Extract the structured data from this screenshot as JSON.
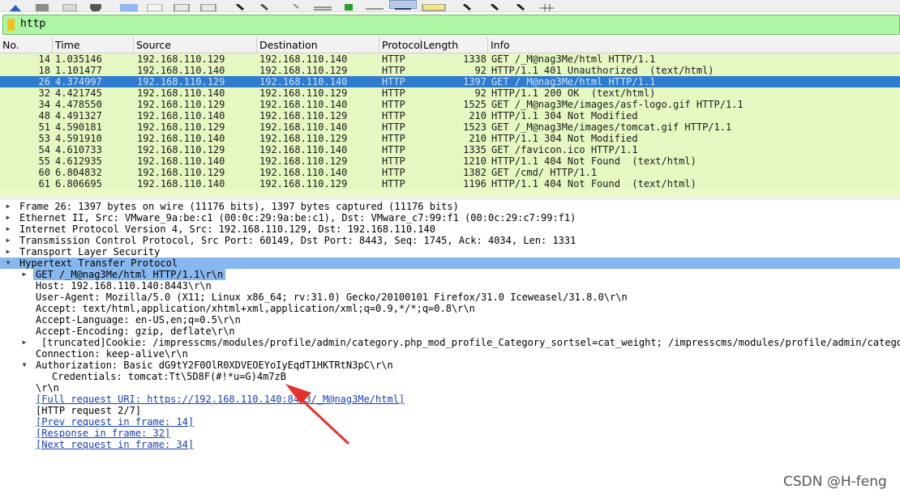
{
  "filter": {
    "text": "http"
  },
  "columns": [
    "No.",
    "Time",
    "Source",
    "Destination",
    "Protocol",
    "Length",
    "Info"
  ],
  "packets": [
    {
      "no": "14",
      "time": "1.035146",
      "src": "192.168.110.129",
      "dst": "192.168.110.140",
      "proto": "HTTP",
      "len": "1338",
      "info": "GET /_M@nag3Me/html HTTP/1.1"
    },
    {
      "no": "18",
      "time": "1.101477",
      "src": "192.168.110.140",
      "dst": "192.168.110.129",
      "proto": "HTTP",
      "len": "92",
      "info": "HTTP/1.1 401 Unauthorized  (text/html)"
    },
    {
      "no": "26",
      "time": "4.374997",
      "src": "192.168.110.129",
      "dst": "192.168.110.140",
      "proto": "HTTP",
      "len": "1397",
      "info": "GET /_M@nag3Me/html HTTP/1.1",
      "selected": true
    },
    {
      "no": "32",
      "time": "4.421745",
      "src": "192.168.110.140",
      "dst": "192.168.110.129",
      "proto": "HTTP",
      "len": "92",
      "info": "HTTP/1.1 200 OK  (text/html)"
    },
    {
      "no": "34",
      "time": "4.478550",
      "src": "192.168.110.129",
      "dst": "192.168.110.140",
      "proto": "HTTP",
      "len": "1525",
      "info": "GET /_M@nag3Me/images/asf-logo.gif HTTP/1.1"
    },
    {
      "no": "48",
      "time": "4.491327",
      "src": "192.168.110.140",
      "dst": "192.168.110.129",
      "proto": "HTTP",
      "len": "210",
      "info": "HTTP/1.1 304 Not Modified"
    },
    {
      "no": "51",
      "time": "4.590181",
      "src": "192.168.110.129",
      "dst": "192.168.110.140",
      "proto": "HTTP",
      "len": "1523",
      "info": "GET /_M@nag3Me/images/tomcat.gif HTTP/1.1"
    },
    {
      "no": "53",
      "time": "4.591910",
      "src": "192.168.110.140",
      "dst": "192.168.110.129",
      "proto": "HTTP",
      "len": "210",
      "info": "HTTP/1.1 304 Not Modified"
    },
    {
      "no": "54",
      "time": "4.610733",
      "src": "192.168.110.129",
      "dst": "192.168.110.140",
      "proto": "HTTP",
      "len": "1335",
      "info": "GET /favicon.ico HTTP/1.1"
    },
    {
      "no": "55",
      "time": "4.612935",
      "src": "192.168.110.140",
      "dst": "192.168.110.129",
      "proto": "HTTP",
      "len": "1210",
      "info": "HTTP/1.1 404 Not Found  (text/html)"
    },
    {
      "no": "60",
      "time": "6.804832",
      "src": "192.168.110.129",
      "dst": "192.168.110.140",
      "proto": "HTTP",
      "len": "1382",
      "info": "GET /cmd/ HTTP/1.1"
    },
    {
      "no": "61",
      "time": "6.806695",
      "src": "192.168.110.140",
      "dst": "192.168.110.129",
      "proto": "HTTP",
      "len": "1196",
      "info": "HTTP/1.1 404 Not Found  (text/html)"
    }
  ],
  "details": {
    "frame": "Frame 26: 1397 bytes on wire (11176 bits), 1397 bytes captured (11176 bits)",
    "ethernet": "Ethernet II, Src: VMware_9a:be:c1 (00:0c:29:9a:be:c1), Dst: VMware_c7:99:f1 (00:0c:29:c7:99:f1)",
    "ip": "Internet Protocol Version 4, Src: 192.168.110.129, Dst: 192.168.110.140",
    "tcp": "Transmission Control Protocol, Src Port: 60149, Dst Port: 8443, Seq: 1745, Ack: 4034, Len: 1331",
    "tls": "Transport Layer Security",
    "http": "Hypertext Transfer Protocol",
    "request_line": "GET /_M@nag3Me/html HTTP/1.1\\r\\n",
    "host": "Host: 192.168.110.140:8443\\r\\n",
    "user_agent": "User-Agent: Mozilla/5.0 (X11; Linux x86_64; rv:31.0) Gecko/20100101 Firefox/31.0 Iceweasel/31.8.0\\r\\n",
    "accept": "Accept: text/html,application/xhtml+xml,application/xml;q=0.9,*/*;q=0.8\\r\\n",
    "accept_language": "Accept-Language: en-US,en;q=0.5\\r\\n",
    "accept_encoding": "Accept-Encoding: gzip, deflate\\r\\n",
    "cookie": "[truncated]Cookie: /impresscms/modules/profile/admin/category.php_mod_profile_Category_sortsel=cat_weight; /impresscms/modules/profile/admin/categor",
    "connection": "Connection: keep-alive\\r\\n",
    "authorization": "Authorization: Basic dG9tY2F0OlR0XDVEOEYoIyEqdT1HKTRtN3pC\\r\\n",
    "credentials": "Credentials: tomcat:Tt\\5D8F(#!*u=G)4m7zB",
    "crlf": "\\r\\n",
    "full_uri": "[Full request URI: https://192.168.110.140:8443/_M@nag3Me/html]",
    "http_request": "[HTTP request 2/7]",
    "prev_request": "[Prev request in frame: 14]",
    "response": "[Response in frame: 32]",
    "next_request": "[Next request in frame: 34]"
  },
  "watermark": "CSDN @H-feng",
  "colors": {
    "selected_row": "#2e7bcf",
    "http_row": "#e6f8c2",
    "filter_ok": "#aff5a6",
    "detail_highlight": "#86b8ef",
    "annotation_arrow": "#e5322d"
  }
}
